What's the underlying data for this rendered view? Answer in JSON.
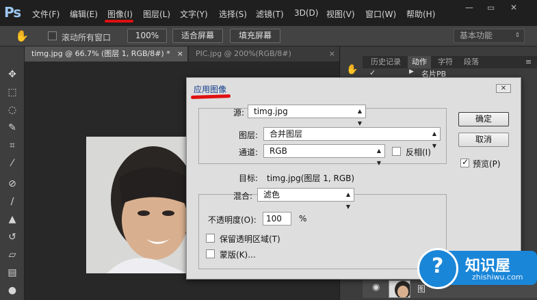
{
  "app": {
    "logo": "Ps"
  },
  "menu": [
    {
      "label": "文件(F)"
    },
    {
      "label": "编辑(E)"
    },
    {
      "label": "图像(I)"
    },
    {
      "label": "图层(L)"
    },
    {
      "label": "文字(Y)"
    },
    {
      "label": "选择(S)"
    },
    {
      "label": "滤镜(T)"
    },
    {
      "label": "3D(D)"
    },
    {
      "label": "视图(V)"
    },
    {
      "label": "窗口(W)"
    },
    {
      "label": "帮助(H)"
    }
  ],
  "window_controls": {
    "minimize": "—",
    "restore": "▭",
    "close": "✕"
  },
  "options_bar": {
    "scroll_all_label": "滚动所有窗口",
    "zoom_100": "100%",
    "fit_screen": "适合屏幕",
    "fill_screen": "填充屏幕",
    "workspace": "基本功能"
  },
  "tabs": [
    {
      "label": "timg.jpg @ 66.7% (图层 1, RGB/8#) *",
      "close": "×"
    },
    {
      "label": "PIC.jpg @ 200%(RGB/8#)",
      "close": "×"
    }
  ],
  "panel": {
    "tabs": [
      "历史记录",
      "动作",
      "字符",
      "段落"
    ],
    "action_item": "名片PB",
    "layer_name_partial": "图"
  },
  "dialog": {
    "title": "应用图像",
    "source_label": "源:",
    "source_value": "timg.jpg",
    "layer_label": "图层:",
    "layer_value": "合并图层",
    "channel_label": "通道:",
    "channel_value": "RGB",
    "invert_label": "反相(I)",
    "target_label": "目标:",
    "target_value": "timg.jpg(图层 1, RGB)",
    "blending_label": "混合:",
    "blending_value": "滤色",
    "opacity_label": "不透明度(O):",
    "opacity_value": "100",
    "opacity_unit": "%",
    "preserve_label": "保留透明区域(T)",
    "mask_label": "蒙版(K)...",
    "ok": "确定",
    "cancel": "取消",
    "preview_label": "预览(P)",
    "preview_checked": true
  },
  "watermark": {
    "title": "知识屋",
    "subtitle": "zhishiwu.com"
  }
}
